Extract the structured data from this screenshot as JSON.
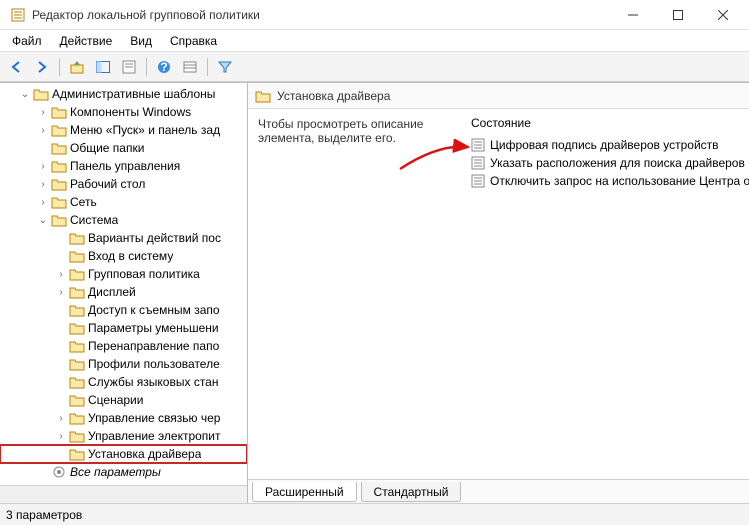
{
  "window": {
    "title": "Редактор локальной групповой политики"
  },
  "menu": {
    "items": [
      "Файл",
      "Действие",
      "Вид",
      "Справка"
    ]
  },
  "tree": {
    "root": {
      "label": "Административные шаблоны"
    },
    "level1": [
      {
        "label": "Компоненты Windows",
        "expandable": true
      },
      {
        "label": "Меню «Пуск» и панель зад",
        "expandable": true
      },
      {
        "label": "Общие папки",
        "expandable": false
      },
      {
        "label": "Панель управления",
        "expandable": true
      },
      {
        "label": "Рабочий стол",
        "expandable": true
      },
      {
        "label": "Сеть",
        "expandable": true
      },
      {
        "label": "Система",
        "expandable": true,
        "expanded": true
      }
    ],
    "system_children": [
      "Варианты действий пос",
      "Вход в систему",
      "Групповая политика",
      "Дисплей",
      "Доступ к съемным запо",
      "Параметры уменьшени",
      "Перенаправление папо",
      "Профили пользователе",
      "Службы языковых стан",
      "Сценарии",
      "Управление связью чер",
      "Управление электропит"
    ],
    "selected": "Установка драйвера",
    "all_params": "Все параметры"
  },
  "right": {
    "title": "Установка драйвера",
    "description": "Чтобы просмотреть описание элемента, выделите его.",
    "state_header": "Состояние",
    "items": [
      "Цифровая подпись драйверов устройств",
      "Указать расположения для поиска драйверов",
      "Отключить запрос на использование Центра о"
    ],
    "tabs": {
      "extended": "Расширенный",
      "standard": "Стандартный"
    }
  },
  "status": {
    "text": "3 параметров"
  }
}
